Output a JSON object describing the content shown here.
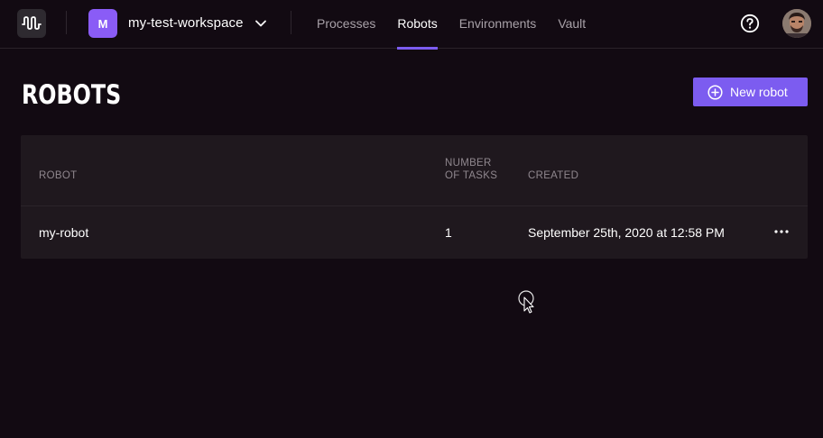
{
  "header": {
    "workspace_initial": "M",
    "workspace_name": "my-test-workspace",
    "nav": [
      {
        "label": "Processes",
        "active": false
      },
      {
        "label": "Robots",
        "active": true
      },
      {
        "label": "Environments",
        "active": false
      },
      {
        "label": "Vault",
        "active": false
      }
    ],
    "icons": {
      "logo": "robocorp-logo-icon",
      "help": "help-circle-icon",
      "chevron": "chevron-down-icon"
    }
  },
  "page": {
    "title": "ROBOTS",
    "new_button_label": "New robot"
  },
  "table": {
    "columns": [
      "ROBOT",
      "NUMBER OF TASKS",
      "CREATED"
    ],
    "rows": [
      {
        "robot": "my-robot",
        "tasks": "1",
        "created": "September 25th, 2020 at 12:58 PM"
      }
    ]
  },
  "colors": {
    "background": "#120a12",
    "accent": "#7c5cf0",
    "table_bg": "#1f181e",
    "muted_text": "#8f878e"
  }
}
